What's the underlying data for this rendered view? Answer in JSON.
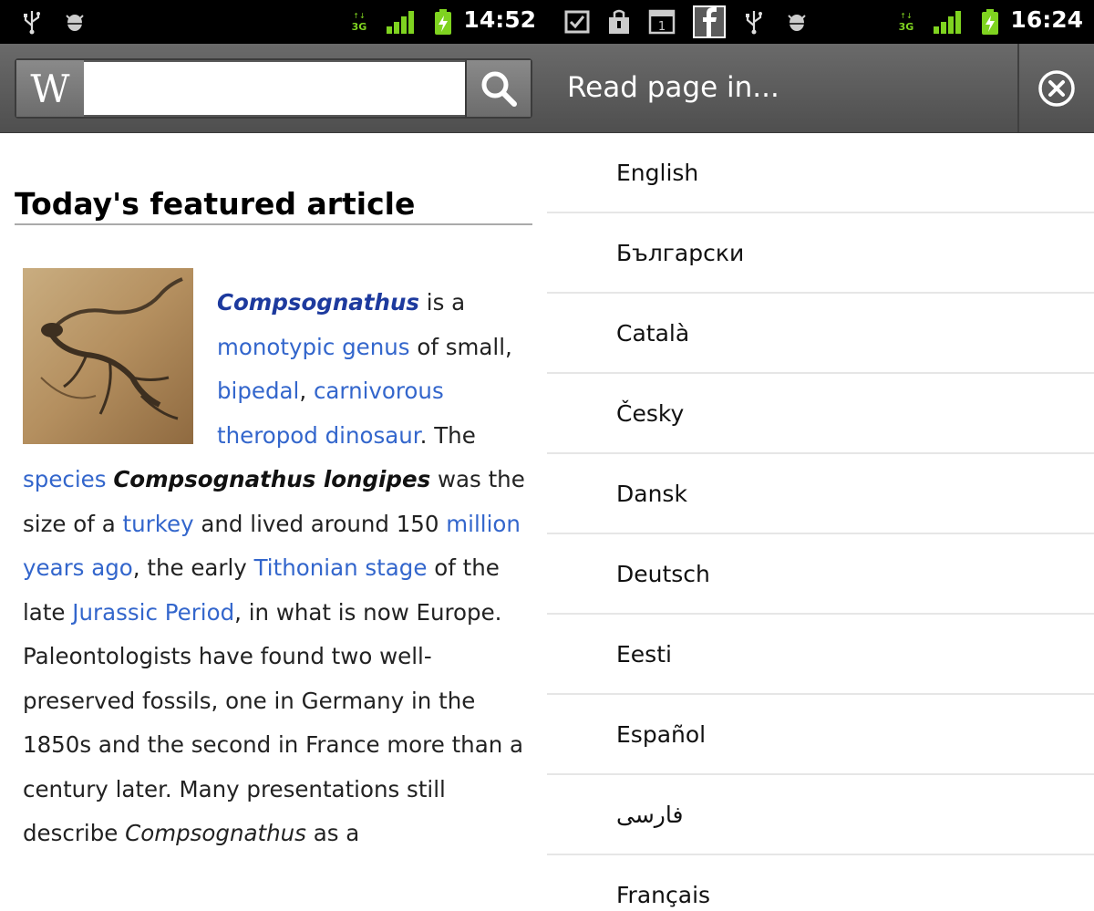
{
  "left_screen": {
    "status_bar": {
      "time": "14:52",
      "network_label": "3G",
      "icons": [
        "usb-icon",
        "android-debug-icon",
        "network-3g-icon",
        "signal-icon",
        "battery-charging-icon"
      ]
    },
    "toolbar": {
      "logo_letter": "W",
      "search_value": "",
      "search_icon": "search-icon"
    },
    "article": {
      "heading": "Today's featured article",
      "segments": [
        {
          "t": "Compsognathus",
          "s": "link-bold-italic"
        },
        {
          "t": " is a ",
          "s": "text"
        },
        {
          "t": "monotypic genus",
          "s": "link"
        },
        {
          "t": " of small, ",
          "s": "text"
        },
        {
          "t": "bipedal",
          "s": "link"
        },
        {
          "t": ", ",
          "s": "text"
        },
        {
          "t": "carnivorous",
          "s": "link"
        },
        {
          "t": " ",
          "s": "text"
        },
        {
          "t": "theropod",
          "s": "link"
        },
        {
          "t": " ",
          "s": "text"
        },
        {
          "t": "dinosaur",
          "s": "link"
        },
        {
          "t": ". The ",
          "s": "text"
        },
        {
          "t": "species",
          "s": "link"
        },
        {
          "t": " ",
          "s": "text"
        },
        {
          "t": "Compsognathus longipes",
          "s": "bold-italic"
        },
        {
          "t": " was the size of a ",
          "s": "text"
        },
        {
          "t": "turkey",
          "s": "link"
        },
        {
          "t": " and lived around 150 ",
          "s": "text"
        },
        {
          "t": "million years ago",
          "s": "link"
        },
        {
          "t": ", the early ",
          "s": "text"
        },
        {
          "t": "Tithonian stage",
          "s": "link"
        },
        {
          "t": " of the late ",
          "s": "text"
        },
        {
          "t": "Jurassic Period",
          "s": "link"
        },
        {
          "t": ", in what is now Europe. Paleontologists have found two well-preserved fossils, one in Germany in the 1850s and the second in France more than a century later. Many presentations still describe ",
          "s": "text"
        },
        {
          "t": "Compsognathus",
          "s": "italic"
        },
        {
          "t": " as a",
          "s": "text"
        }
      ]
    }
  },
  "right_screen": {
    "status_bar": {
      "time": "16:24",
      "network_label": "3G",
      "icons": [
        "checkbox-notification-icon",
        "shopping-bag-icon",
        "calendar-icon",
        "facebook-icon",
        "usb-icon",
        "android-debug-icon",
        "network-3g-icon",
        "signal-icon",
        "battery-charging-icon"
      ],
      "calendar_day": "1"
    },
    "toolbar": {
      "title": "Read page in...",
      "close_icon": "close-icon"
    },
    "languages": [
      "English",
      "Български",
      "Català",
      "Česky",
      "Dansk",
      "Deutsch",
      "Eesti",
      "Español",
      "فارسی",
      "Français"
    ]
  },
  "colors": {
    "link": "#3366cc",
    "bold_link": "#1d3a9e",
    "toolbar": "#5e5e5e",
    "status_bar": "#000000",
    "signal_green": "#7fd320"
  }
}
